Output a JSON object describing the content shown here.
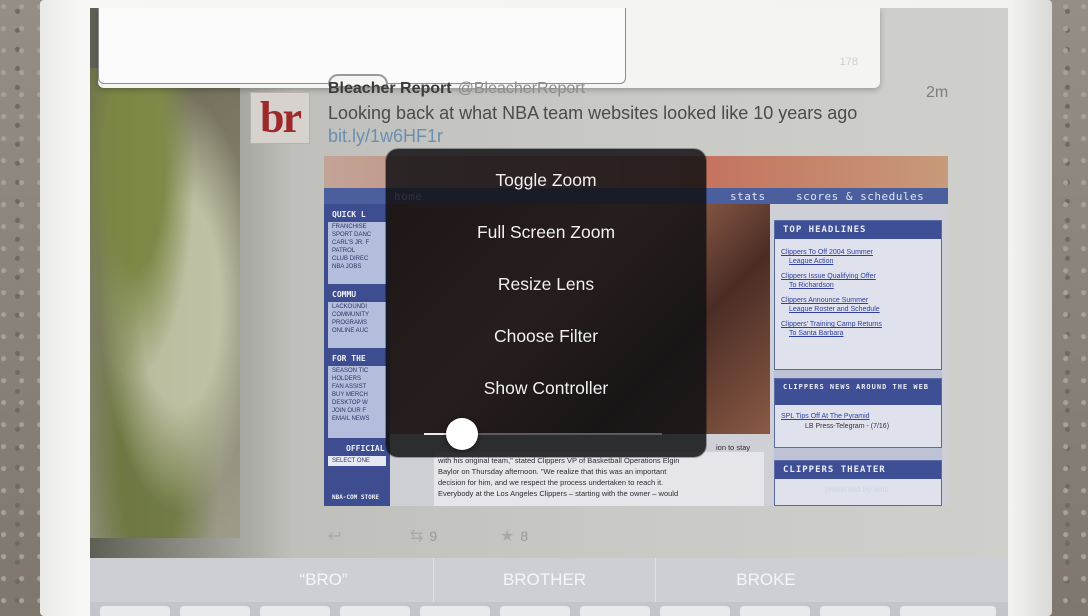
{
  "popover": {
    "count": "178"
  },
  "tweet": {
    "avatar_text": "br",
    "author": "Bleacher Report",
    "handle": "@BleacherReport",
    "time": "2m",
    "text": "Looking back at what NBA team websites looked like 10 years ago ",
    "link": "bit.ly/1w6HF1r",
    "embedded_site": {
      "nav": [
        "home",
        "stats",
        "scores & schedules"
      ],
      "left_headers": [
        "QUICK L",
        "COMMU",
        "FOR THE",
        "OFFICIAL",
        "NBA-COM STORE"
      ],
      "left_lines": [
        "FRANCHISE",
        "SPORT DANC",
        "CARL'S JR. F",
        "PATROL",
        "CLUB DIREC",
        "NBA JOBS",
        "LACKOUNDI",
        "COMMUNITY",
        "PROGRAMS",
        "ONLINE AUC",
        "SEASON TIC",
        "HOLDERS",
        "FAN ASSIST",
        "BUY MERCH",
        "DESKTOP W",
        "JOIN OUR F",
        "EMAIL NEWS",
        "SELECT ONE"
      ],
      "body_lines": [
        "with his original team,\" stated Clippers VP of Basketball Operations Elgin",
        "Baylor on Thursday afternoon. \"We realize that this was an important",
        "decision for him, and we respect the process undertaken to reach it.",
        "Everybody at the Los Angeles Clippers – starting with the owner – would"
      ],
      "body_partial_right": "ion to stay",
      "right_boxes": [
        {
          "title": "TOP HEADLINES",
          "links": [
            "Clippers To Off 2004 Summer",
            "League Action",
            "Clippers Issue Qualifying Offer",
            "To Richardson",
            "Clippers Announce Summer",
            "League Roster and Schedule",
            "Clippers' Training Camp Returns",
            "To Santa Barbara"
          ]
        },
        {
          "title": "CLIPPERS NEWS AROUND THE WEB",
          "links": [
            "SPL Tips Off At The Pyramid",
            "LB Press-Telegram - (7/16)"
          ]
        },
        {
          "title": "CLIPPERS THEATER",
          "links": [
            "presented by amc"
          ]
        }
      ]
    },
    "actions": {
      "retweets": "9",
      "favorites": "8"
    }
  },
  "zoom_menu": {
    "items": [
      "Toggle Zoom",
      "Full Screen Zoom",
      "Resize Lens",
      "Choose Filter",
      "Show Controller"
    ],
    "zoom_level": 0.16
  },
  "keyboard": {
    "suggestions": [
      "“BRO”",
      "BROTHER",
      "BROKE"
    ]
  },
  "colors": {
    "menu_bg": "#121214",
    "menu_text": "#f2f2f2",
    "link": "#6a8fb0",
    "br_red": "#9d2a2a"
  },
  "icons": [
    "reply-icon",
    "retweet-icon",
    "favorite-star-icon"
  ]
}
